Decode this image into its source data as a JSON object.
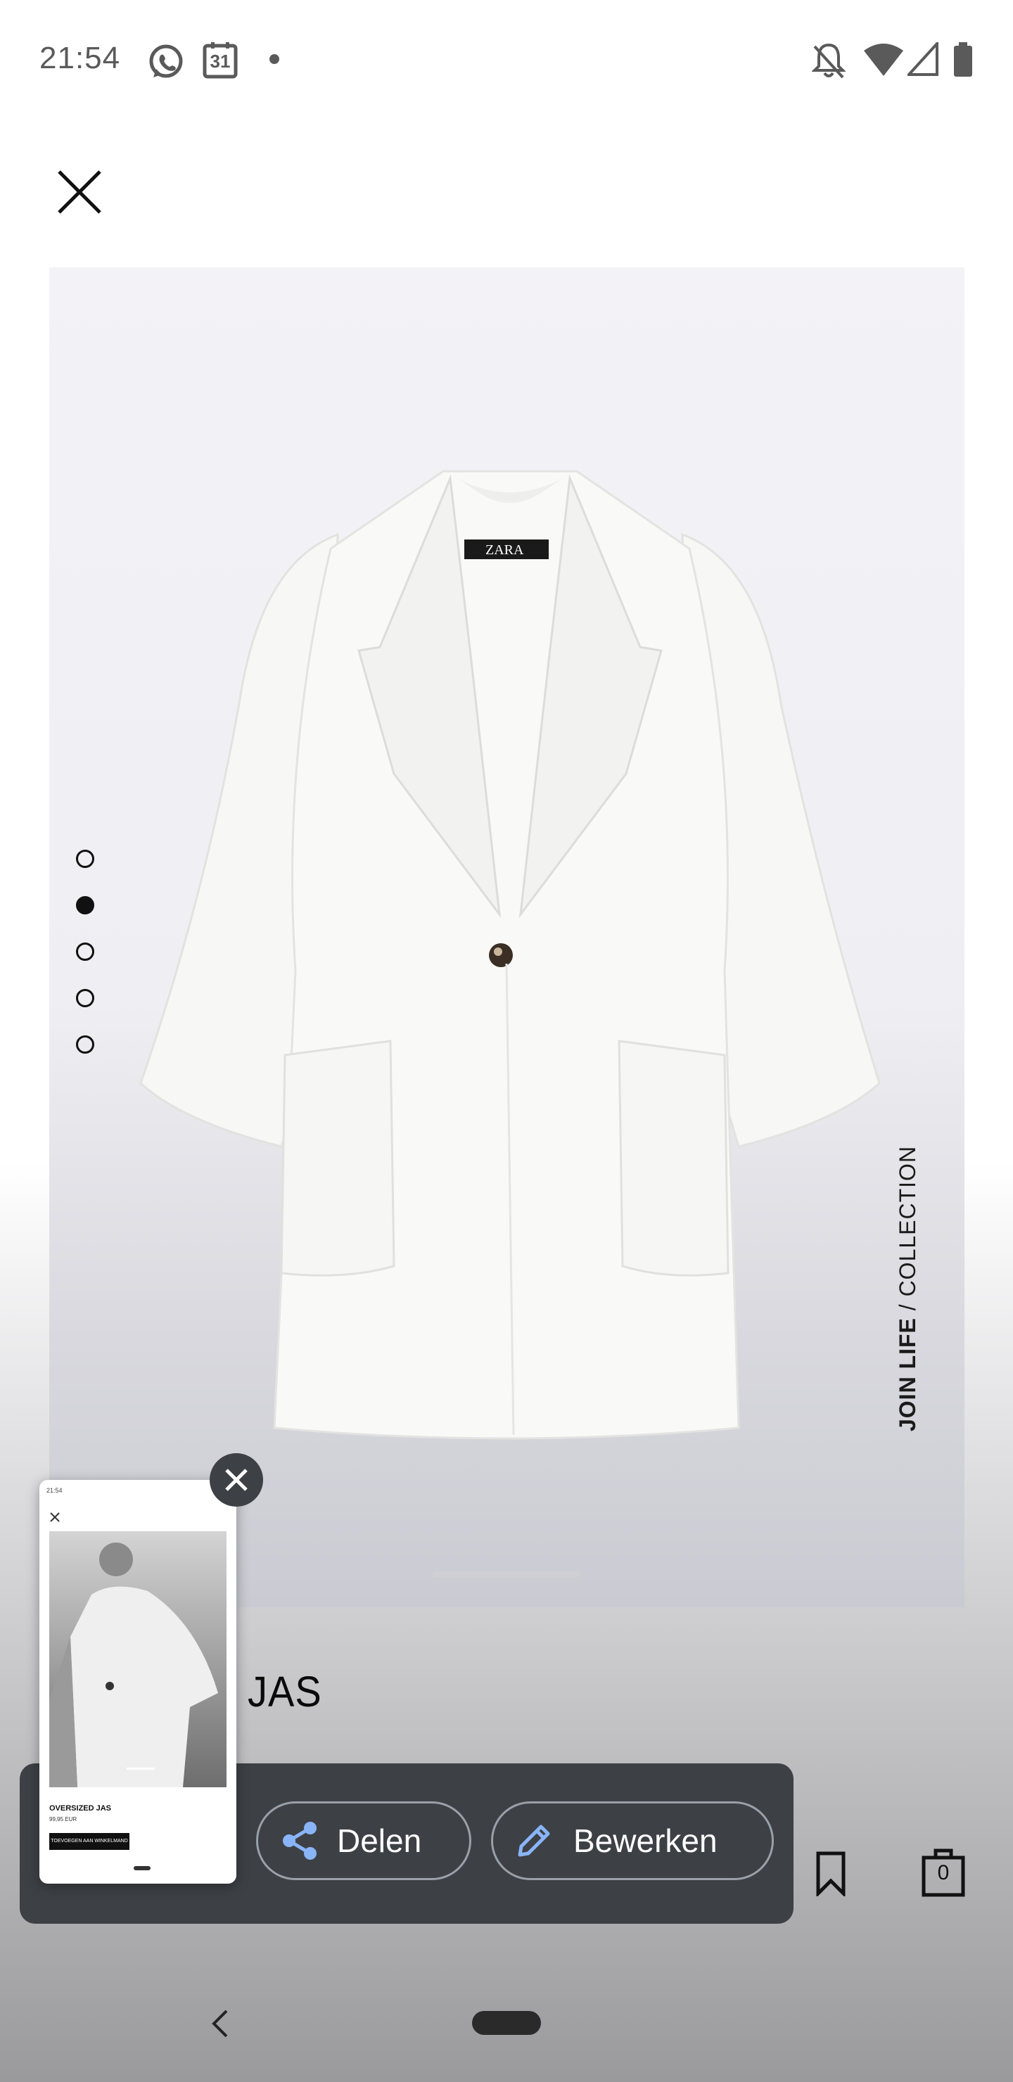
{
  "status_bar": {
    "time": "21:54",
    "left_icons": [
      "whatsapp-icon",
      "calendar-icon",
      "notification-dot-icon"
    ],
    "calendar_day": "31",
    "right_icons": [
      "notifications-off-icon",
      "wifi-icon",
      "cellular-signal-icon",
      "battery-icon"
    ]
  },
  "product": {
    "image_dots": {
      "count": 5,
      "active_index": 1
    },
    "vertical_label_strong": "JOIN LIFE",
    "vertical_label_rest": " / COLLECTION",
    "title": "JAS",
    "cart_count": "0"
  },
  "screenshot_preview": {
    "time": "21:54",
    "title": "OVERSIZED JAS",
    "price": "99,95 EUR",
    "add_to_cart": "TOEVOEGEN AAN WINKELMAND"
  },
  "share_panel": {
    "share_label": "Delen",
    "edit_label": "Bewerken"
  },
  "colors": {
    "panel_bg": "#3d4045",
    "icon_blue": "#8ab4f8",
    "text_dark": "#0a0a0a"
  }
}
